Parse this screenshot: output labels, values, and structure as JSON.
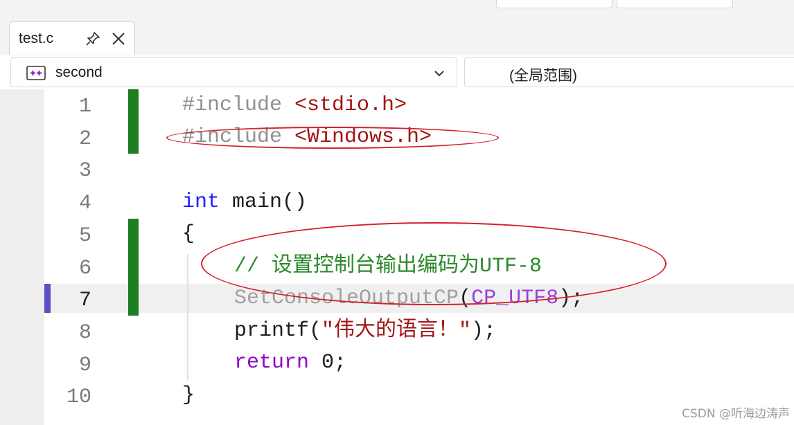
{
  "tab": {
    "title": "test.c"
  },
  "navbar": {
    "scope_left": "second",
    "scope_right": "(全局范围)"
  },
  "editor": {
    "line_numbers": [
      "1",
      "2",
      "3",
      "4",
      "5",
      "6",
      "7",
      "8",
      "9",
      "10"
    ],
    "current_line": "7",
    "lines": {
      "l1_directive": "#include ",
      "l1_header": "<stdio.h>",
      "l2_directive": "#include ",
      "l2_header": "<Windows.h>",
      "l4_type": "int",
      "l4_rest": " main()",
      "l5": "{",
      "l6_comment": "// 设置控制台输出编码为UTF-8",
      "l7_func": "SetConsoleOutputCP",
      "l7_paren_open": "(",
      "l7_arg": "CP_UTF8",
      "l7_end": ");",
      "l8_func": "printf(",
      "l8_str": "\"伟大的语言！\"",
      "l8_end": ");",
      "l9_kw": "return",
      "l9_rest": " 0;",
      "l10": "}"
    }
  },
  "watermark": "CSDN @听海边涛声",
  "colors": {
    "change_bar": "#1e7d23",
    "annotation": "#d4202a",
    "breakpoint_marker": "#5a4fc9"
  }
}
